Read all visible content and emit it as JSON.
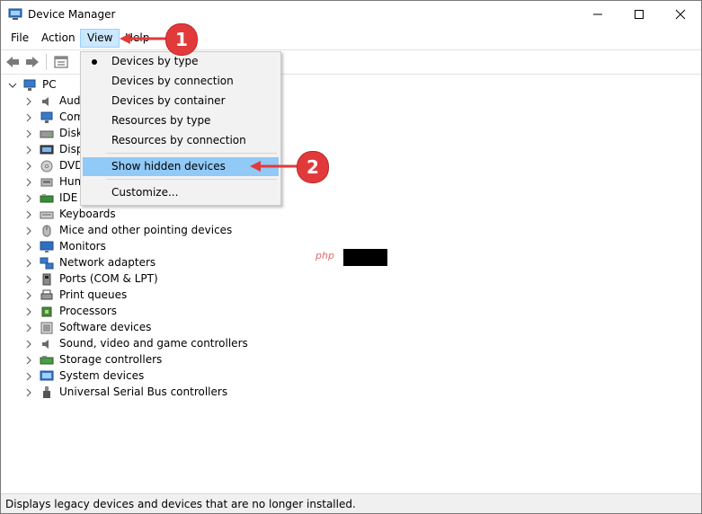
{
  "window": {
    "title": "Device Manager"
  },
  "menubar": {
    "items": [
      "File",
      "Action",
      "View",
      "Help"
    ]
  },
  "view_menu": {
    "items": [
      {
        "label": "Devices by type",
        "checked": true
      },
      {
        "label": "Devices by connection",
        "checked": false
      },
      {
        "label": "Devices by container",
        "checked": false
      },
      {
        "label": "Resources by type",
        "checked": false
      },
      {
        "label": "Resources by connection",
        "checked": false
      },
      {
        "label": "Show hidden devices",
        "checked": false,
        "highlighted": true
      },
      {
        "label": "Customize...",
        "checked": false
      }
    ]
  },
  "tree": {
    "root": "PC",
    "items": [
      {
        "label": "Audio inputs and outputs",
        "visible_label": "Aud",
        "icon": "speaker-icon"
      },
      {
        "label": "Computer",
        "visible_label": "Com",
        "icon": "computer-icon"
      },
      {
        "label": "Disk drives",
        "visible_label": "Disk",
        "icon": "disk-icon"
      },
      {
        "label": "Display adapters",
        "visible_label": "Disp",
        "icon": "display-icon"
      },
      {
        "label": "DVD/CD-ROM drives",
        "visible_label": "DVD",
        "icon": "dvd-icon"
      },
      {
        "label": "Human Interface Devices",
        "visible_label": "Hum",
        "icon": "hid-icon"
      },
      {
        "label": "IDE ATA/ATAPI controllers",
        "visible_label": "IDE A",
        "icon": "ide-icon"
      },
      {
        "label": "Keyboards",
        "visible_label": "Keyboards",
        "icon": "keyboard-icon"
      },
      {
        "label": "Mice and other pointing devices",
        "visible_label": "Mice and other pointing devices",
        "icon": "mouse-icon"
      },
      {
        "label": "Monitors",
        "visible_label": "Monitors",
        "icon": "monitor-icon"
      },
      {
        "label": "Network adapters",
        "visible_label": "Network adapters",
        "icon": "network-icon"
      },
      {
        "label": "Ports (COM & LPT)",
        "visible_label": "Ports (COM & LPT)",
        "icon": "port-icon"
      },
      {
        "label": "Print queues",
        "visible_label": "Print queues",
        "icon": "printer-icon"
      },
      {
        "label": "Processors",
        "visible_label": "Processors",
        "icon": "processor-icon"
      },
      {
        "label": "Software devices",
        "visible_label": "Software devices",
        "icon": "software-icon"
      },
      {
        "label": "Sound, video and game controllers",
        "visible_label": "Sound, video and game controllers",
        "icon": "speaker-icon"
      },
      {
        "label": "Storage controllers",
        "visible_label": "Storage controllers",
        "icon": "storage-icon"
      },
      {
        "label": "System devices",
        "visible_label": "System devices",
        "icon": "system-icon"
      },
      {
        "label": "Universal Serial Bus controllers",
        "visible_label": "Universal Serial Bus controllers",
        "icon": "usb-icon"
      }
    ]
  },
  "statusbar": {
    "text": "Displays legacy devices and devices that are no longer installed."
  },
  "callouts": {
    "one": "1",
    "two": "2"
  },
  "watermark": {
    "text": "php"
  },
  "colors": {
    "accent": "#e23a3a",
    "highlight": "#91c9f7",
    "menu_active": "#cce8ff"
  }
}
